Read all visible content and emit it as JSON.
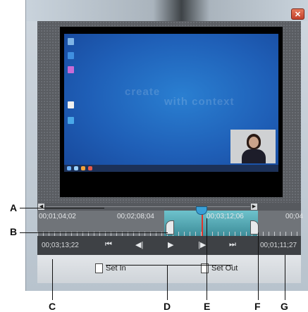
{
  "window": {
    "close_glyph": "✕"
  },
  "preview": {
    "watermark_line1": "create",
    "watermark_line2": "with context"
  },
  "timeline": {
    "time_label_1": "00;01;04;02",
    "time_label_2": "00;02;08;04",
    "time_label_3": "00;03;12;06",
    "time_label_4": "00;04"
  },
  "controls": {
    "current_time": "00;03;13;22",
    "duration": "00;01;11;27",
    "btn_go_start": "⏮",
    "btn_step_back": "◀|",
    "btn_play": "▶",
    "btn_step_forward": "|▶",
    "btn_go_end": "⏭"
  },
  "set_bar": {
    "set_in_label": "Set In",
    "set_out_label": "Set Out"
  },
  "callouts": {
    "a": "A",
    "b": "B",
    "c": "C",
    "d": "D",
    "e": "E",
    "f": "F",
    "g": "G"
  }
}
